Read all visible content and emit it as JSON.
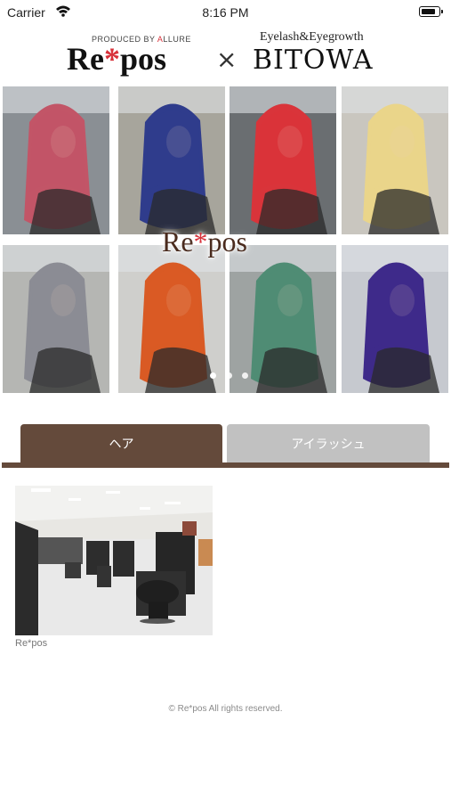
{
  "status_bar": {
    "carrier": "Carrier",
    "time": "8:16 PM",
    "battery_level": 0.85
  },
  "header": {
    "brand_left_tagline_pre": "PRODUCED BY ",
    "brand_left_tagline_a": "A",
    "brand_left_tagline_post": "LLURE",
    "brand_left_prefix": "Re",
    "brand_left_star": "*",
    "brand_left_suffix": "pos",
    "separator": "×",
    "brand_right_tagline": "Eyelash&Eyegrowth",
    "brand_right_name": "BITOWA"
  },
  "gallery": {
    "overlay_logo_prefix": "Re",
    "overlay_logo_star": "*",
    "overlay_logo_suffix": "pos",
    "slide_count": 3,
    "active_slide": 0,
    "photos": [
      {
        "name": "pink-long-hair-photo",
        "hair": "#c25567",
        "bg": "#8a8f94"
      },
      {
        "name": "blue-straight-hair-photo",
        "hair": "#2f3c8c",
        "bg": "#a7a59c"
      },
      {
        "name": "red-wavy-hair-photo",
        "hair": "#d9343a",
        "bg": "#6a6e71"
      },
      {
        "name": "blonde-hair-photo",
        "hair": "#ead58a",
        "bg": "#c9c6bf"
      },
      {
        "name": "silver-gray-bob-photo",
        "hair": "#8b8c94",
        "bg": "#b5b6b3"
      },
      {
        "name": "orange-wavy-hair-photo",
        "hair": "#d95a24",
        "bg": "#cfcfcc"
      },
      {
        "name": "green-hair-photo",
        "hair": "#4f8c74",
        "bg": "#9ea3a2"
      },
      {
        "name": "purple-wavy-hair-photo",
        "hair": "#3e2a8a",
        "bg": "#c6c9cf"
      }
    ]
  },
  "tabs": [
    {
      "label": "ヘア",
      "active": true
    },
    {
      "label": "アイラッシュ",
      "active": false
    }
  ],
  "content": {
    "salon_card_label": "Re*pos"
  },
  "footer": {
    "copyright": "© Re*pos All rights reserved."
  },
  "colors": {
    "accent": "#644a3b",
    "tab_inactive": "#c1c1c1",
    "logo_accent_red": "#d8313a"
  }
}
